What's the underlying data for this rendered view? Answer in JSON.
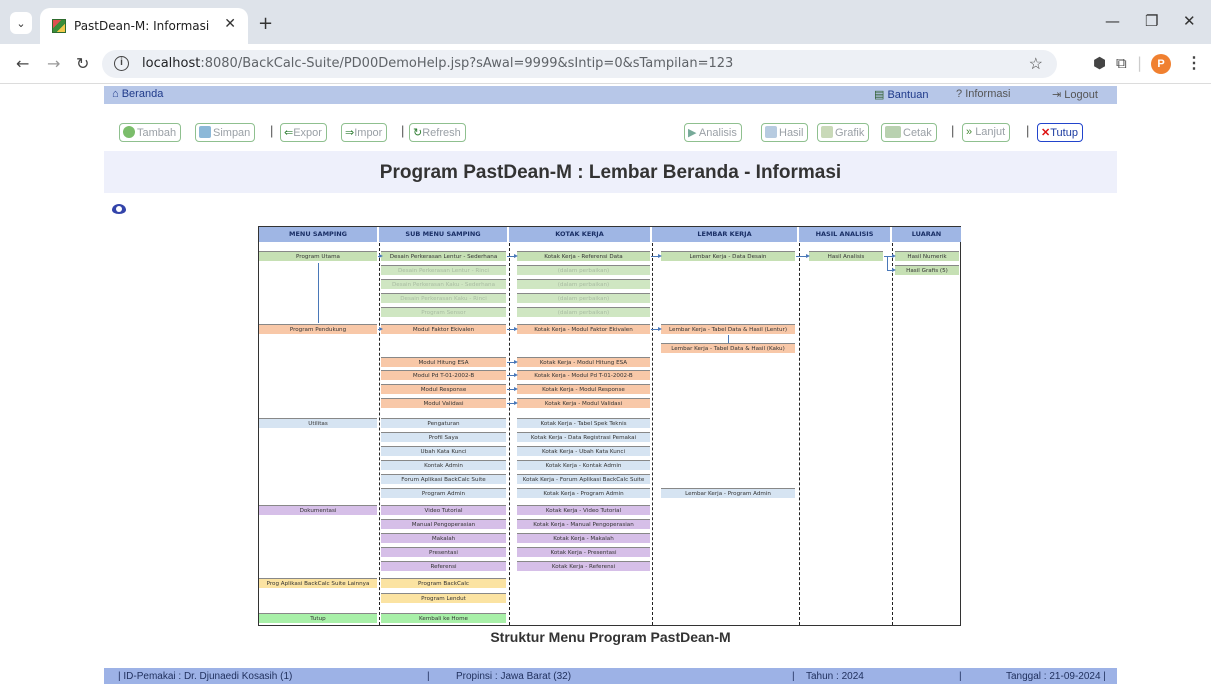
{
  "browser": {
    "tab_title": "PastDean-M: Informasi",
    "url_host": "localhost",
    "url_rest": ":8080/BackCalc-Suite/PD00DemoHelp.jsp?sAwal=9999&sIntip=0&sTampilan=123",
    "profile_initial": "P"
  },
  "app": {
    "top": {
      "home": "Beranda",
      "help": "Bantuan",
      "info": "Informasi",
      "logout": "Logout"
    },
    "toolbar": {
      "add": "Tambah",
      "save": "Simpan",
      "export": "Expor",
      "import": "Impor",
      "refresh": "Refresh",
      "analysis": "Analisis",
      "result": "Hasil",
      "graph": "Grafik",
      "print": "Cetak",
      "next": "Lanjut",
      "close": "Tutup"
    },
    "page_title": "Program PastDean-M : Lembar Beranda - Informasi",
    "caption": "Struktur Menu Program PastDean-M",
    "status": {
      "user": "| ID-Pemakai : Dr. Djunaedi Kosasih (1)",
      "province": "Propinsi : Jawa Barat (32)",
      "year": "Tahun : 2024",
      "date": "Tanggal : 21-09-2024 |"
    }
  },
  "diagram": {
    "headers": [
      "MENU SAMPING",
      "SUB MENU SAMPING",
      "KOTAK KERJA",
      "LEMBAR KERJA",
      "HASIL ANALISIS",
      "LUARAN"
    ],
    "menu": [
      "Program Utama",
      "Program Pendukung",
      "Utilitas",
      "Dokumentasi",
      "Prog Aplikasi BackCalc Suite Lainnya",
      "Tutup"
    ],
    "sub": [
      "Desain Perkerasan Lentur - Sederhana",
      "Desain Perkerasan Lentur - Rinci",
      "Desain Perkerasan Kaku - Sederhana",
      "Desain Perkerasan Kaku - Rinci",
      "Program Sensor",
      "Modul Faktor Ekivalen",
      "Modul Hitung ESA",
      "Modul Pd T-01-2002-B",
      "Modul Response",
      "Modul Validasi",
      "Pengaturan",
      "Profil Saya",
      "Ubah Kata Kunci",
      "Kontak Admin",
      "Forum Aplikasi BackCalc Suite",
      "Program Admin",
      "Video Tutorial",
      "Manual Pengoperasian",
      "Makalah",
      "Presentasi",
      "Referensi",
      "Program BackCalc",
      "Program Lendut",
      "Kembali ke Home"
    ],
    "work": [
      "Kotak Kerja - Referensi Data",
      "(dalam perbaikan)",
      "(dalam perbaikan)",
      "(dalam perbaikan)",
      "(dalam perbaikan)",
      "Kotak Kerja - Modul Faktor Ekivalen",
      "Kotak Kerja - Modul Hitung ESA",
      "Kotak Kerja - Modul Pd T-01-2002-B",
      "Kotak Kerja - Modul Response",
      "Kotak Kerja - Modul Validasi",
      "Kotak Kerja - Tabel Spek Teknis",
      "Kotak Kerja - Data Registrasi Pemakai",
      "Kotak Kerja - Ubah Kata Kunci",
      "Kotak Kerja - Kontak Admin",
      "Kotak Kerja - Forum Aplikasi BackCalc Suite",
      "Kotak Kerja - Program Admin",
      "Kotak Kerja - Video Tutorial",
      "Kotak Kerja - Manual Pengoperasian",
      "Kotak Kerja - Makalah",
      "Kotak Kerja - Presentasi",
      "Kotak Kerja - Referensi"
    ],
    "sheet": [
      "Lembar Kerja - Data Desain",
      "Lembar Kerja - Tabel Data & Hasil (Lentur)",
      "Lembar Kerja - Tabel Data & Hasil (Kaku)",
      "Lembar Kerja - Program Admin"
    ],
    "analysis": [
      "Hasil Analisis"
    ],
    "output": [
      "Hasil Numerik",
      "Hasil Grafis (5)"
    ]
  }
}
